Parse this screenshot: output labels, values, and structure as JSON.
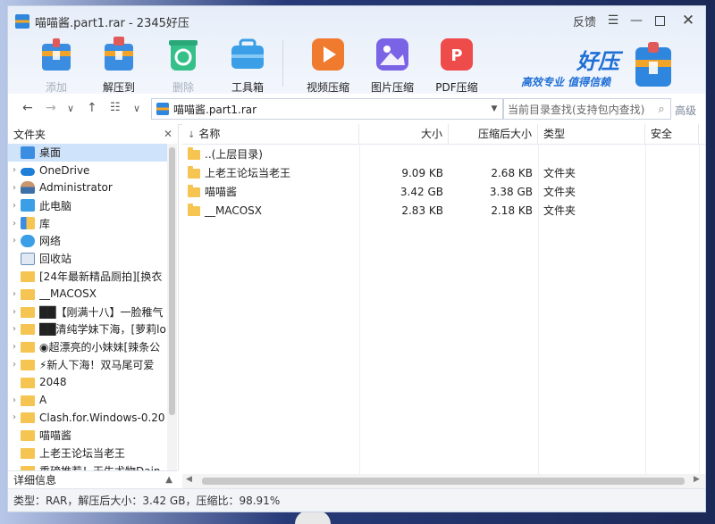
{
  "window": {
    "title": "喵喵酱.part1.rar - 2345好压",
    "feedback": "反馈"
  },
  "toolbar": {
    "items": [
      {
        "label": "添加",
        "icon": "add-archive-icon",
        "disabled": true
      },
      {
        "label": "解压到",
        "icon": "extract-icon",
        "disabled": false
      },
      {
        "label": "删除",
        "icon": "recycle-delete-icon",
        "disabled": true
      },
      {
        "label": "工具箱",
        "icon": "toolbox-icon",
        "disabled": false
      },
      {
        "label": "视频压缩",
        "icon": "video-compress-icon",
        "disabled": false
      },
      {
        "label": "图片压缩",
        "icon": "image-compress-icon",
        "disabled": false
      },
      {
        "label": "PDF压缩",
        "icon": "pdf-compress-icon",
        "disabled": false
      }
    ],
    "brand_name": "好压",
    "brand_slogan": "高效专业  值得信赖"
  },
  "address": {
    "path": "喵喵酱.part1.rar",
    "search_placeholder": "当前目录查找(支持包内查找)",
    "advanced_label": "高级"
  },
  "left_panel": {
    "header": "文件夹",
    "detail_header": "详细信息",
    "items": [
      {
        "label": "桌面",
        "icon": "desktop-icon",
        "arrow": false,
        "selected": true
      },
      {
        "label": "OneDrive",
        "icon": "cloud-icon",
        "arrow": true
      },
      {
        "label": "Administrator",
        "icon": "user-icon",
        "arrow": true
      },
      {
        "label": "此电脑",
        "icon": "computer-icon",
        "arrow": true
      },
      {
        "label": "库",
        "icon": "library-icon",
        "arrow": true
      },
      {
        "label": "网络",
        "icon": "network-icon",
        "arrow": true
      },
      {
        "label": "回收站",
        "icon": "recycle-bin-icon",
        "arrow": false
      },
      {
        "label": "[24年最新精品厕拍][换衣",
        "icon": "folder-icon",
        "arrow": false
      },
      {
        "label": "__MACOSX",
        "icon": "folder-icon",
        "arrow": true
      },
      {
        "label": "██【刚满十八】一脸稚气",
        "icon": "folder-icon",
        "arrow": true
      },
      {
        "label": "██清纯学妹下海，[萝莉lo",
        "icon": "folder-icon",
        "arrow": true
      },
      {
        "label": "◉超漂亮的小妹妹[辣条公",
        "icon": "folder-icon",
        "arrow": true
      },
      {
        "label": "⚡新人下海！双马尾可爱",
        "icon": "folder-icon",
        "arrow": true
      },
      {
        "label": "2048",
        "icon": "folder-icon",
        "arrow": false
      },
      {
        "label": "A",
        "icon": "folder-icon",
        "arrow": true
      },
      {
        "label": "Clash.for.Windows-0.20",
        "icon": "folder-icon",
        "arrow": true
      },
      {
        "label": "喵喵酱",
        "icon": "folder-icon",
        "arrow": false
      },
      {
        "label": "上老王论坛当老王",
        "icon": "folder-icon",
        "arrow": false
      },
      {
        "label": "重磅推荐！天生尤物Dain",
        "icon": "folder-icon",
        "arrow": false
      }
    ]
  },
  "file_list": {
    "columns": [
      "名称",
      "大小",
      "压缩后大小",
      "类型",
      "安全"
    ],
    "rows": [
      {
        "name": "..(上层目录)",
        "size": "",
        "packed": "",
        "type": ""
      },
      {
        "name": "上老王论坛当老王",
        "size": "9.09 KB",
        "packed": "2.68 KB",
        "type": "文件夹"
      },
      {
        "name": "喵喵酱",
        "size": "3.42 GB",
        "packed": "3.38 GB",
        "type": "文件夹"
      },
      {
        "name": "__MACOSX",
        "size": "2.83 KB",
        "packed": "2.18 KB",
        "type": "文件夹"
      }
    ]
  },
  "status": {
    "text": "类型：RAR，解压后大小：3.42 GB，压缩比：98.91%"
  },
  "colors": {
    "accent": "#2f86de",
    "brand_blue": "#1f6fd6",
    "folder": "#f5c451"
  }
}
